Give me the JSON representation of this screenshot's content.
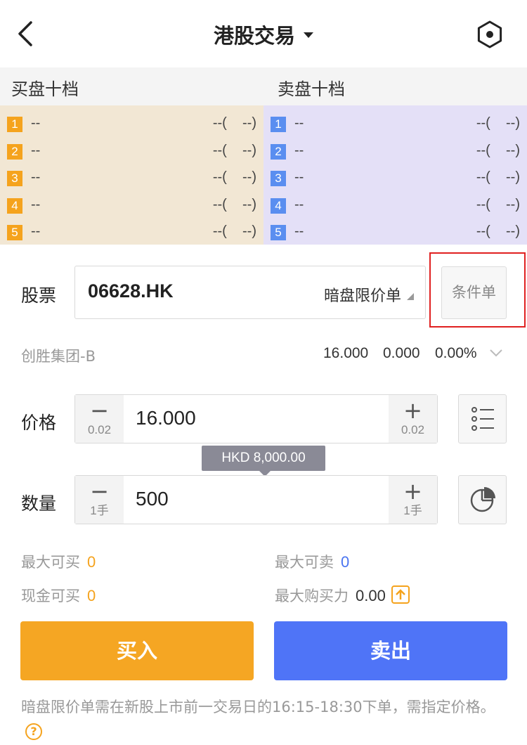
{
  "header": {
    "title": "港股交易"
  },
  "order_book": {
    "bid_title": "买盘十档",
    "ask_title": "卖盘十档",
    "bid_levels": [
      {
        "n": "1",
        "price": "--",
        "qty": "--(    --)"
      },
      {
        "n": "2",
        "price": "--",
        "qty": "--(    --)"
      },
      {
        "n": "3",
        "price": "--",
        "qty": "--(    --)"
      },
      {
        "n": "4",
        "price": "--",
        "qty": "--(    --)"
      },
      {
        "n": "5",
        "price": "--",
        "qty": "--(    --)"
      }
    ],
    "ask_levels": [
      {
        "n": "1",
        "price": "--",
        "qty": "--(    --)"
      },
      {
        "n": "2",
        "price": "--",
        "qty": "--(    --)"
      },
      {
        "n": "3",
        "price": "--",
        "qty": "--(    --)"
      },
      {
        "n": "4",
        "price": "--",
        "qty": "--(    --)"
      },
      {
        "n": "5",
        "price": "--",
        "qty": "--(    --)"
      }
    ]
  },
  "stock": {
    "label": "股票",
    "code": "06628.HK",
    "order_type": "暗盘限价单",
    "condition_button": "条件单",
    "name": "创胜集团-B",
    "last": "16.000",
    "change": "0.000",
    "change_pct": "0.00%"
  },
  "price": {
    "label": "价格",
    "value": "16.000",
    "minus_step": "0.02",
    "plus_step": "0.02"
  },
  "tooltip": "HKD 8,000.00",
  "quantity": {
    "label": "数量",
    "value": "500",
    "minus_step": "1手",
    "plus_step": "1手"
  },
  "capacity": {
    "max_buy_label": "最大可买",
    "max_buy": "0",
    "max_sell_label": "最大可卖",
    "max_sell": "0",
    "cash_buy_label": "现金可买",
    "cash_buy": "0",
    "max_power_label": "最大购买力",
    "max_power": "0.00"
  },
  "actions": {
    "buy": "买入",
    "sell": "卖出"
  },
  "notice": "暗盘限价单需在新股上市前一交易日的16:15-18:30下单，需指定价格。",
  "colors": {
    "buy": "#f5a623",
    "sell": "#4f74f7",
    "bid_bg": "#f2e7d4",
    "ask_bg": "#e4e0f7",
    "highlight": "#e02020"
  }
}
